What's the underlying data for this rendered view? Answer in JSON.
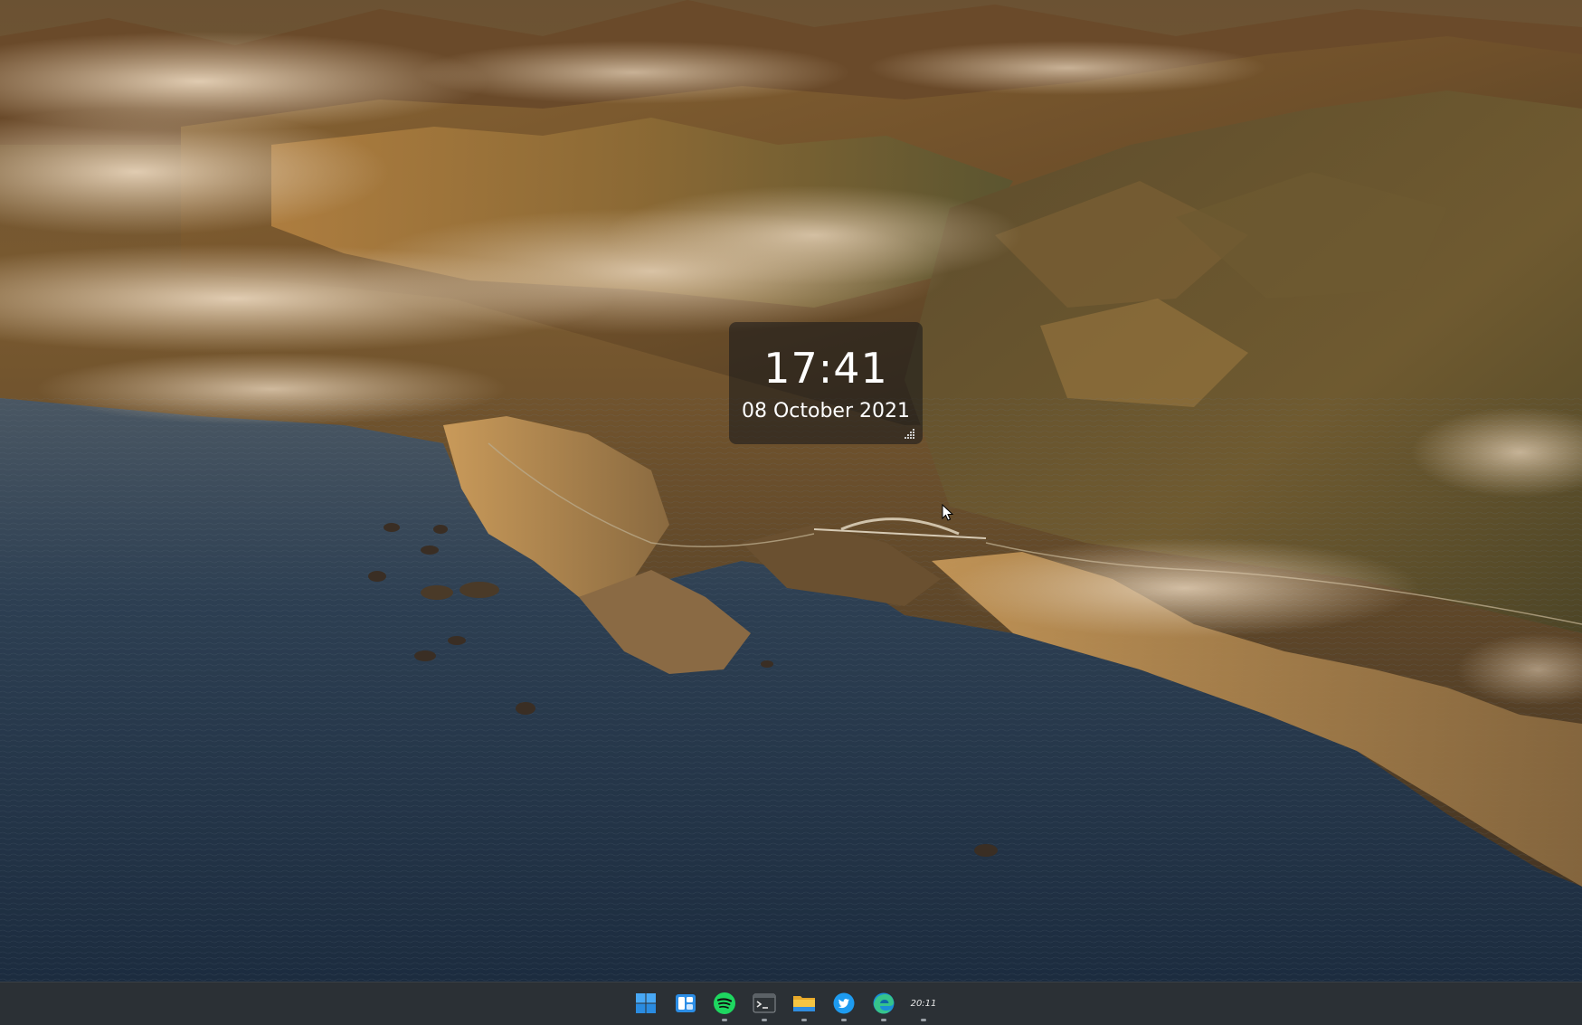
{
  "wallpaper": {
    "description_icon": "landscape-wallpaper"
  },
  "clock_widget": {
    "time": "17:41",
    "date": "08 October 2021"
  },
  "taskbar": {
    "apps": [
      {
        "name": "start",
        "icon": "windows-start-icon",
        "running": false
      },
      {
        "name": "widgets",
        "icon": "widgets-icon",
        "running": false
      },
      {
        "name": "spotify",
        "icon": "spotify-icon",
        "running": true
      },
      {
        "name": "terminal",
        "icon": "terminal-icon",
        "running": true
      },
      {
        "name": "file-explorer",
        "icon": "folder-icon",
        "running": true
      },
      {
        "name": "twitter",
        "icon": "twitter-icon",
        "running": true
      },
      {
        "name": "edge",
        "icon": "edge-icon",
        "running": true
      },
      {
        "name": "clock-app",
        "icon": "clock-text-icon",
        "running": true
      }
    ],
    "clock_app_label": "20:11"
  },
  "colors": {
    "taskbar_bg": "#2b3035",
    "windows_blue": "#3fa0f0",
    "spotify_green": "#1ed760",
    "twitter_blue": "#1d9bf0",
    "folder_yellow": "#f3c23c"
  }
}
